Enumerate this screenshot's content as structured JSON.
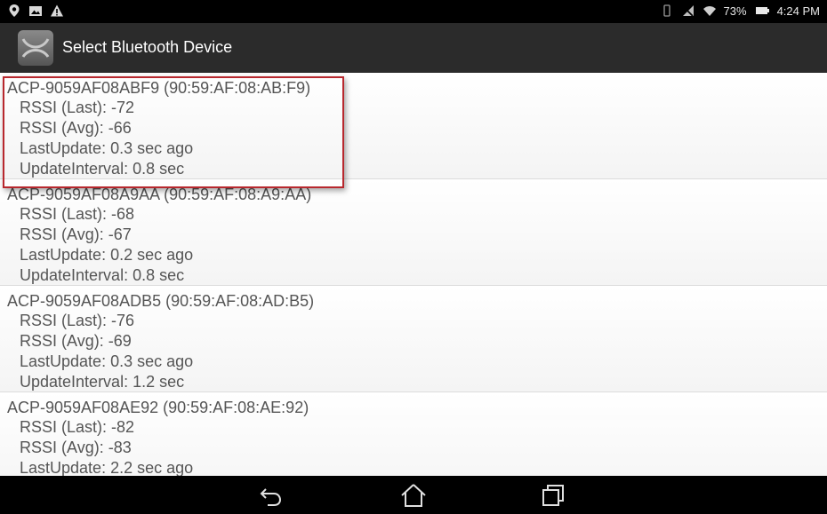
{
  "status_bar": {
    "battery": "73%",
    "time": "4:24 PM",
    "left_icons": [
      "location-icon",
      "image-notification-icon",
      "warning-icon"
    ],
    "right_icons": [
      "vibrate-icon",
      "no-signal-icon",
      "wifi-icon",
      "battery-icon"
    ]
  },
  "action_bar": {
    "title": "Select Bluetooth Device",
    "icon": "app-icon",
    "background": "#2b2b2b"
  },
  "devices": [
    {
      "name": "ACP-9059AF08ABF9 (90:59:AF:08:AB:F9)",
      "rssi_last": "RSSI (Last): -72",
      "rssi_avg": "RSSI (Avg): -66",
      "last_update": "LastUpdate: 0.3 sec ago",
      "update_interval": "UpdateInterval: 0.8 sec"
    },
    {
      "name": "ACP-9059AF08A9AA (90:59:AF:08:A9:AA)",
      "rssi_last": "RSSI (Last): -68",
      "rssi_avg": "RSSI (Avg): -67",
      "last_update": "LastUpdate: 0.2 sec ago",
      "update_interval": "UpdateInterval: 0.8 sec"
    },
    {
      "name": "ACP-9059AF08ADB5 (90:59:AF:08:AD:B5)",
      "rssi_last": "RSSI (Last): -76",
      "rssi_avg": "RSSI (Avg): -69",
      "last_update": "LastUpdate: 0.3 sec ago",
      "update_interval": "UpdateInterval: 1.2 sec"
    },
    {
      "name": "ACP-9059AF08AE92 (90:59:AF:08:AE:92)",
      "rssi_last": "RSSI (Last): -82",
      "rssi_avg": "RSSI (Avg): -83",
      "last_update": "LastUpdate: 2.2 sec ago",
      "update_interval": ""
    }
  ],
  "highlight_color": "#b8282e",
  "nav_bar": {
    "buttons": [
      "back-icon",
      "home-icon",
      "recent-apps-icon"
    ]
  }
}
